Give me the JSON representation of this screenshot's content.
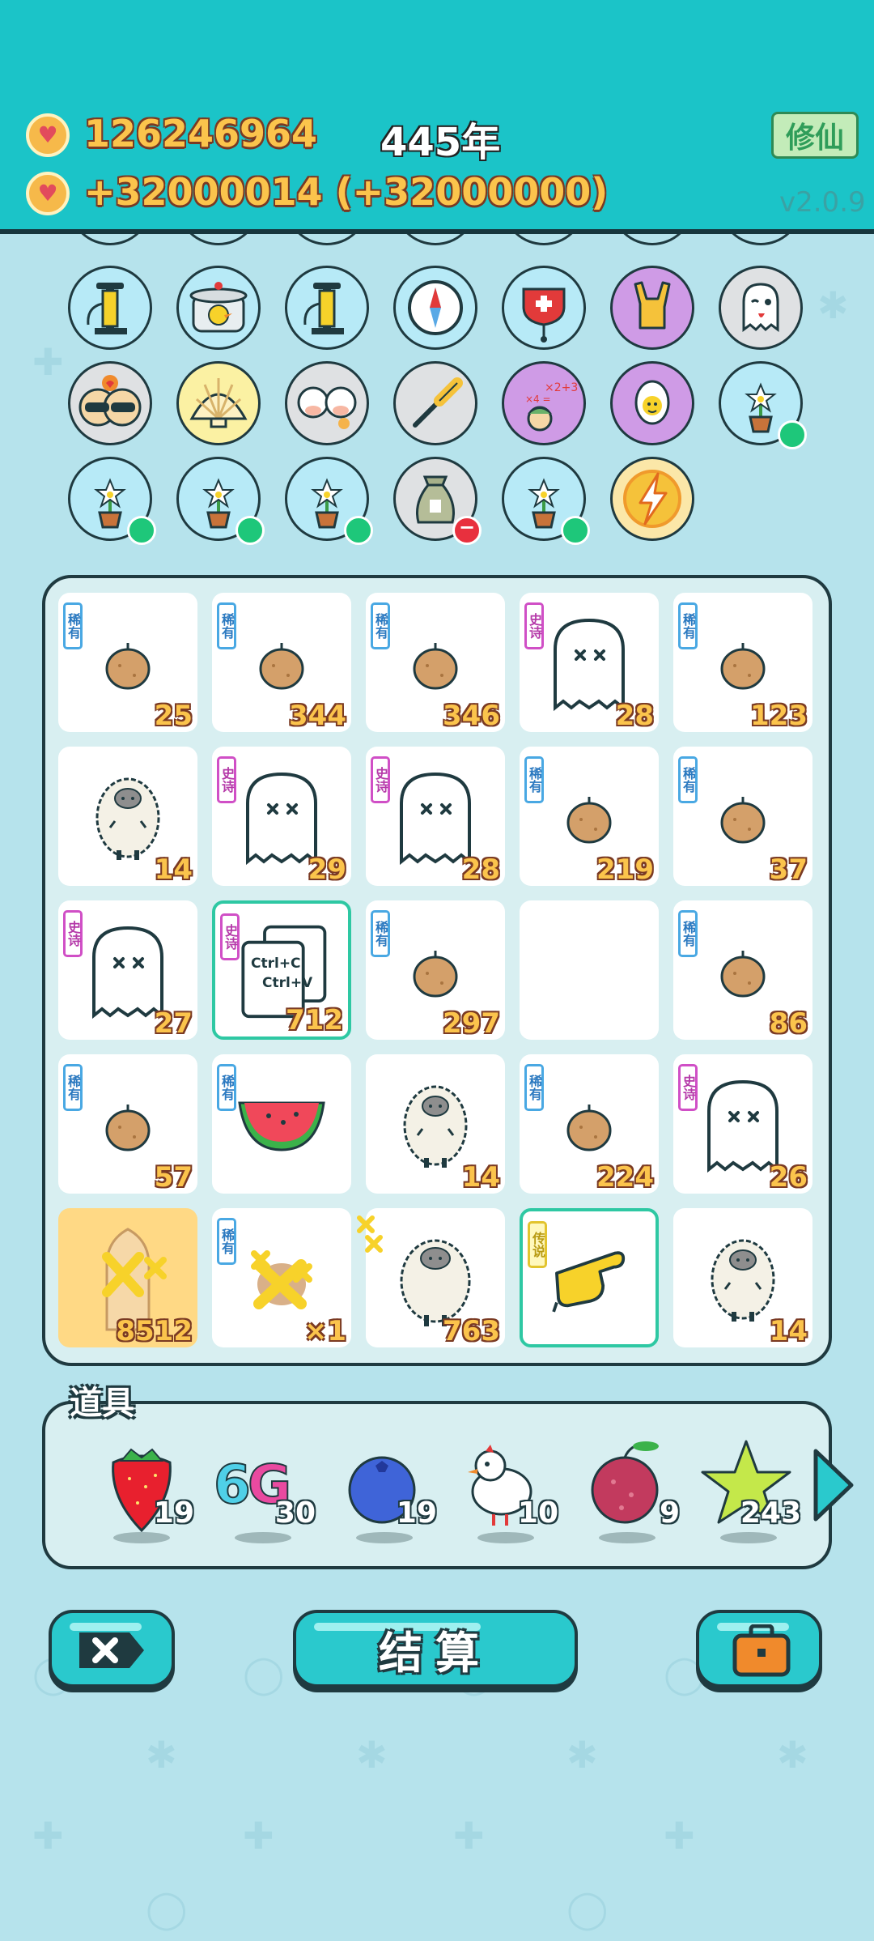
{
  "header": {
    "coins": "126246964",
    "income": "+32000014 (+32000000)",
    "year": "445年",
    "mode_button": "修仙",
    "version": "v2.0.9"
  },
  "relics": [
    {
      "icon": "tire-pump-icon",
      "status": "none"
    },
    {
      "icon": "pressure-cooker-duck-icon",
      "status": "none"
    },
    {
      "icon": "tire-pump-icon",
      "status": "none"
    },
    {
      "icon": "compass-icon",
      "status": "none"
    },
    {
      "icon": "blood-bag-icon",
      "status": "none"
    },
    {
      "icon": "rock-hand-icon",
      "status": "none"
    },
    {
      "icon": "ghost-wink-icon",
      "status": "none"
    },
    {
      "icon": "sunglasses-cats-icon",
      "status": "none"
    },
    {
      "icon": "seashell-icon",
      "status": "none"
    },
    {
      "icon": "twin-cows-icon",
      "status": "none"
    },
    {
      "icon": "screwdriver-icon",
      "status": "none"
    },
    {
      "icon": "math-head-icon",
      "status": "none"
    },
    {
      "icon": "egg-in-cup-icon",
      "status": "none"
    },
    {
      "icon": "potted-flower-icon",
      "status": "active"
    },
    {
      "icon": "potted-flower-icon",
      "status": "active"
    },
    {
      "icon": "potted-flower-icon",
      "status": "active"
    },
    {
      "icon": "potted-flower-icon",
      "status": "active"
    },
    {
      "icon": "money-bag-icon",
      "status": "disabled"
    },
    {
      "icon": "potted-flower-icon",
      "status": "active"
    },
    {
      "icon": "lightning-icon",
      "status": "none"
    }
  ],
  "rarity_labels": {
    "rare": "稀有",
    "epic": "史诗",
    "legendary": "传说"
  },
  "board": [
    {
      "item": "potato",
      "rarity": "rare",
      "count": "25"
    },
    {
      "item": "potato",
      "rarity": "rare",
      "count": "344"
    },
    {
      "item": "potato",
      "rarity": "rare",
      "count": "346"
    },
    {
      "item": "ghost",
      "rarity": "epic",
      "count": "28"
    },
    {
      "item": "potato",
      "rarity": "rare",
      "count": "123"
    },
    {
      "item": "sheep",
      "rarity": "",
      "count": "14"
    },
    {
      "item": "ghost",
      "rarity": "epic",
      "count": "29"
    },
    {
      "item": "ghost",
      "rarity": "epic",
      "count": "28"
    },
    {
      "item": "potato",
      "rarity": "rare",
      "count": "219"
    },
    {
      "item": "potato",
      "rarity": "rare",
      "count": "37"
    },
    {
      "item": "ghost",
      "rarity": "epic",
      "count": "27"
    },
    {
      "item": "copypaste",
      "rarity": "epic",
      "count": "712",
      "selected": true,
      "text1": "Ctrl+C",
      "text2": "Ctrl+V"
    },
    {
      "item": "potato",
      "rarity": "rare",
      "count": "297"
    },
    {
      "item": "empty",
      "rarity": "",
      "count": ""
    },
    {
      "item": "potato",
      "rarity": "rare",
      "count": "86"
    },
    {
      "item": "potato",
      "rarity": "rare",
      "count": "57"
    },
    {
      "item": "watermelon",
      "rarity": "rare",
      "count": ""
    },
    {
      "item": "sheep",
      "rarity": "",
      "count": "14"
    },
    {
      "item": "potato",
      "rarity": "rare",
      "count": "224"
    },
    {
      "item": "ghost",
      "rarity": "epic",
      "count": "26"
    },
    {
      "item": "bottle-x",
      "rarity": "",
      "count": "8512",
      "gold": true
    },
    {
      "item": "potato-x",
      "rarity": "rare",
      "count": "×1"
    },
    {
      "item": "sheep-x",
      "rarity": "",
      "count": "763"
    },
    {
      "item": "pointing-hand",
      "rarity": "legendary",
      "count": "",
      "selected": true
    },
    {
      "item": "sheep",
      "rarity": "",
      "count": "14"
    }
  ],
  "props": {
    "title": "道具",
    "items": [
      {
        "icon": "strawberry-icon",
        "count": "19"
      },
      {
        "icon": "6g-icon",
        "label": "6G",
        "count": "30"
      },
      {
        "icon": "blueberry-icon",
        "count": "19"
      },
      {
        "icon": "white-bird-icon",
        "count": "10"
      },
      {
        "icon": "lychee-icon",
        "count": "9"
      },
      {
        "icon": "star-icon",
        "count": "243"
      }
    ]
  },
  "buttons": {
    "close_icon": "close-x-icon",
    "settle_label": "结算",
    "bag_icon": "briefcase-icon"
  },
  "colors": {
    "header": "#1bc4c8",
    "background": "#b6e3ec",
    "gold_text": "#fbc44c",
    "rare": "#49a8e3",
    "epic": "#d04fc6",
    "legendary": "#e2c42e",
    "active_dot": "#1ec77a"
  }
}
